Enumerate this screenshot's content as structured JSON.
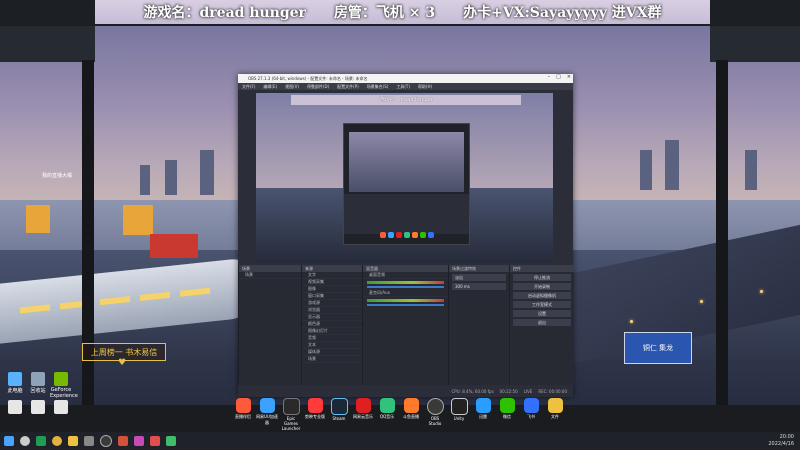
{
  "banner": {
    "game": "游戏名：dread hunger",
    "admin": "房管：飞机 × 3",
    "card": "办卡+VX:Sayayyyyy 进VX群"
  },
  "desktop_icons": [
    {
      "label": "此电脑",
      "color": "#5ab2ff",
      "icon": "computer-icon"
    },
    {
      "label": "回收站",
      "color": "#8fa3b8",
      "icon": "recycle-bin-icon"
    },
    {
      "label": "GeForce Experience",
      "color": "#76b900",
      "icon": "nvidia-icon"
    },
    {
      "label": "",
      "color": "#e6e6e6",
      "icon": "file-icon"
    },
    {
      "label": "",
      "color": "#e6e6e6",
      "icon": "file-icon"
    },
    {
      "label": "",
      "color": "#e6e6e6",
      "icon": "file-icon"
    }
  ],
  "chat": {
    "username": "我的直播大橘"
  },
  "sub_banner": {
    "text": "上周榜一  书木易信"
  },
  "obs": {
    "title": "OBS 27.1.3 (64-bit, windows) - 配置文件: 未命名 - 场景: 未命名",
    "menu": [
      "文件(F)",
      "编辑(E)",
      "视图(V)",
      "停靠部件(D)",
      "配置文件(P)",
      "场景集合(S)",
      "工具(T)",
      "帮助(H)"
    ],
    "docks": {
      "scenes": "场景",
      "sources": "来源",
      "mixer": "混音器",
      "transitions": "场景过渡特效",
      "controls": "控件"
    },
    "scene_list": [
      "场景"
    ],
    "source_list": [
      "文字",
      "视频采集",
      "图像",
      "窗口采集",
      "游戏源",
      "浏览器",
      "显示器",
      "颜色源",
      "图像幻灯片",
      "音频",
      "文本",
      "媒体源",
      "场景"
    ],
    "mixer_tracks": [
      "桌面音频",
      "麦克风/Aux"
    ],
    "transition": "淡出",
    "duration": "300 ms",
    "controls": [
      "停止推流",
      "开始录制",
      "启动虚拟摄像机",
      "工作室模式",
      "设置",
      "退出"
    ],
    "status": [
      "CPU: 8.4%, 60.00 fps",
      "00:22:50",
      "LIVE",
      "REC: 00:00:00"
    ]
  },
  "apps": [
    {
      "label": "直播伴侣",
      "color": "#ff5a3c",
      "icon": "live-icon"
    },
    {
      "label": "网易UU加速器",
      "color": "#3ba3ff",
      "icon": "uu-icon"
    },
    {
      "label": "Epic Games Launcher",
      "color": "#2a2a2a",
      "icon": "epic-icon"
    },
    {
      "label": "剪映专业版",
      "color": "#ff3a3a",
      "icon": "capcut-icon"
    },
    {
      "label": "Steam",
      "color": "#1b2838",
      "icon": "steam-icon"
    },
    {
      "label": "网易云音乐",
      "color": "#e02020",
      "icon": "music-icon"
    },
    {
      "label": "QQ音乐",
      "color": "#31c27c",
      "icon": "qqmusic-icon"
    },
    {
      "label": "斗鱼直播",
      "color": "#ff7a2c",
      "icon": "douyu-icon"
    },
    {
      "label": "OBS Studio",
      "color": "#3a3a3a",
      "icon": "obs-icon"
    },
    {
      "label": "Unity",
      "color": "#222",
      "icon": "unity-icon"
    },
    {
      "label": "迅雷",
      "color": "#2a9dff",
      "icon": "thunder-icon"
    },
    {
      "label": "微信",
      "color": "#2dc100",
      "icon": "wechat-icon"
    },
    {
      "label": "飞书",
      "color": "#3370ff",
      "icon": "feishu-icon"
    },
    {
      "label": "文件",
      "color": "#f0c040",
      "icon": "folder-icon"
    }
  ],
  "street_sign": {
    "text": "铜仁 集龙"
  },
  "taskbar": {
    "icons": [
      {
        "icon": "windows-icon",
        "color": "#4aa3ff"
      },
      {
        "icon": "search-icon",
        "color": "#cccccc"
      },
      {
        "icon": "edge-icon",
        "color": "#1f9d55"
      },
      {
        "icon": "chrome-icon",
        "color": "#e3b23c"
      },
      {
        "icon": "folder-icon",
        "color": "#f0c040"
      },
      {
        "icon": "settings-icon",
        "color": "#888888"
      },
      {
        "icon": "obs-icon",
        "color": "#3a3a3a"
      },
      {
        "icon": "app-icon",
        "color": "#d6513c"
      },
      {
        "icon": "app-icon",
        "color": "#c84bb5"
      },
      {
        "icon": "app-icon",
        "color": "#e24d4d"
      },
      {
        "icon": "app-icon",
        "color": "#3fbf6c"
      }
    ],
    "time": "20:00",
    "date": "2022/4/16"
  }
}
